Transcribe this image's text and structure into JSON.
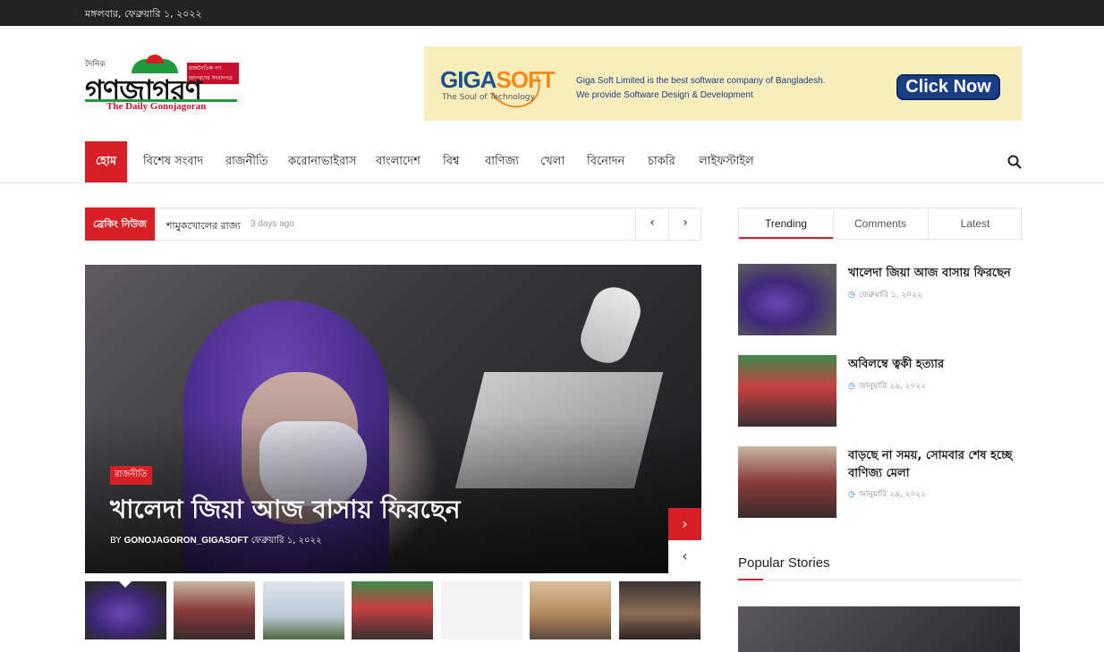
{
  "topbar": {
    "date": "মঙ্গলবার, ফেব্রুয়ারি ১, ২০২২"
  },
  "logo": {
    "small_top": "দৈনিক",
    "tagline": "রাজনৈতিক গণ জাগরণের সংবাদপত্র",
    "name": "গণজাগরণ",
    "english": "The Daily Gonojagoran"
  },
  "ad": {
    "brand_a": "GIGA",
    "brand_b": "SOFT",
    "slogan": "The Soul of Technology",
    "line1": "Giga Soft Limited is the best software company of Bangladesh.",
    "line2": "We provide Software Design & Development",
    "cta": "Click Now",
    "colors": {
      "background": "#f7eebc",
      "brand_blue": "#1e4e8c",
      "brand_orange": "#f08a1c",
      "cta": "#1a3e86"
    }
  },
  "nav": {
    "items": [
      "হোম",
      "বিশেষ সংবাদ",
      "রাজনীতি",
      "করোনাভাইরাস",
      "বাংলাদেশ",
      "বিশ্ব",
      "বাণিজ্য",
      "খেলা",
      "বিনোদন",
      "চাকরি",
      "লাইফস্টাইল"
    ],
    "active": "হোম",
    "search_icon": "search-icon"
  },
  "breaking": {
    "label": "ব্রেকিং নিউজ",
    "headline": "শামুকখোলের রাজ্য",
    "ago": "3 days ago",
    "prev": "‹",
    "next": "›"
  },
  "hero": {
    "category": "রাজনীতি",
    "title": "খালেদা জিয়া আজ বাসায় ফিরছেন",
    "by": "BY",
    "author": "GONOJAGORON_GIGASOFT",
    "date": "ফেব্রুয়ারি ১, ২০২২",
    "next": "›",
    "prev": "‹"
  },
  "thumbs": [
    "hijab",
    "crowd",
    "birds",
    "rally",
    "blank",
    "mountain",
    "food"
  ],
  "sidebar": {
    "tabs": [
      "Trending",
      "Comments",
      "Latest"
    ],
    "active_tab": "Trending",
    "stories": [
      {
        "title": "খালেদা জিয়া আজ বাসায় ফিরছেন",
        "date": "ফেব্রুয়ারি ১, ২০২২"
      },
      {
        "title": "অবিলম্বে ত্বকী হত্যার",
        "date": "জানুয়ারি ২৯, ২০২২"
      },
      {
        "title": "বাড়ছে না সময়, সোমবার শেষ হচ্ছে বাণিজ্য মেলা",
        "date": "জানুয়ারি ২৯, ২০২২"
      }
    ],
    "popular_heading": "Popular Stories"
  },
  "colors": {
    "accent": "#d91f26",
    "topbar": "#222222",
    "date_icon": "#2a82d8"
  }
}
